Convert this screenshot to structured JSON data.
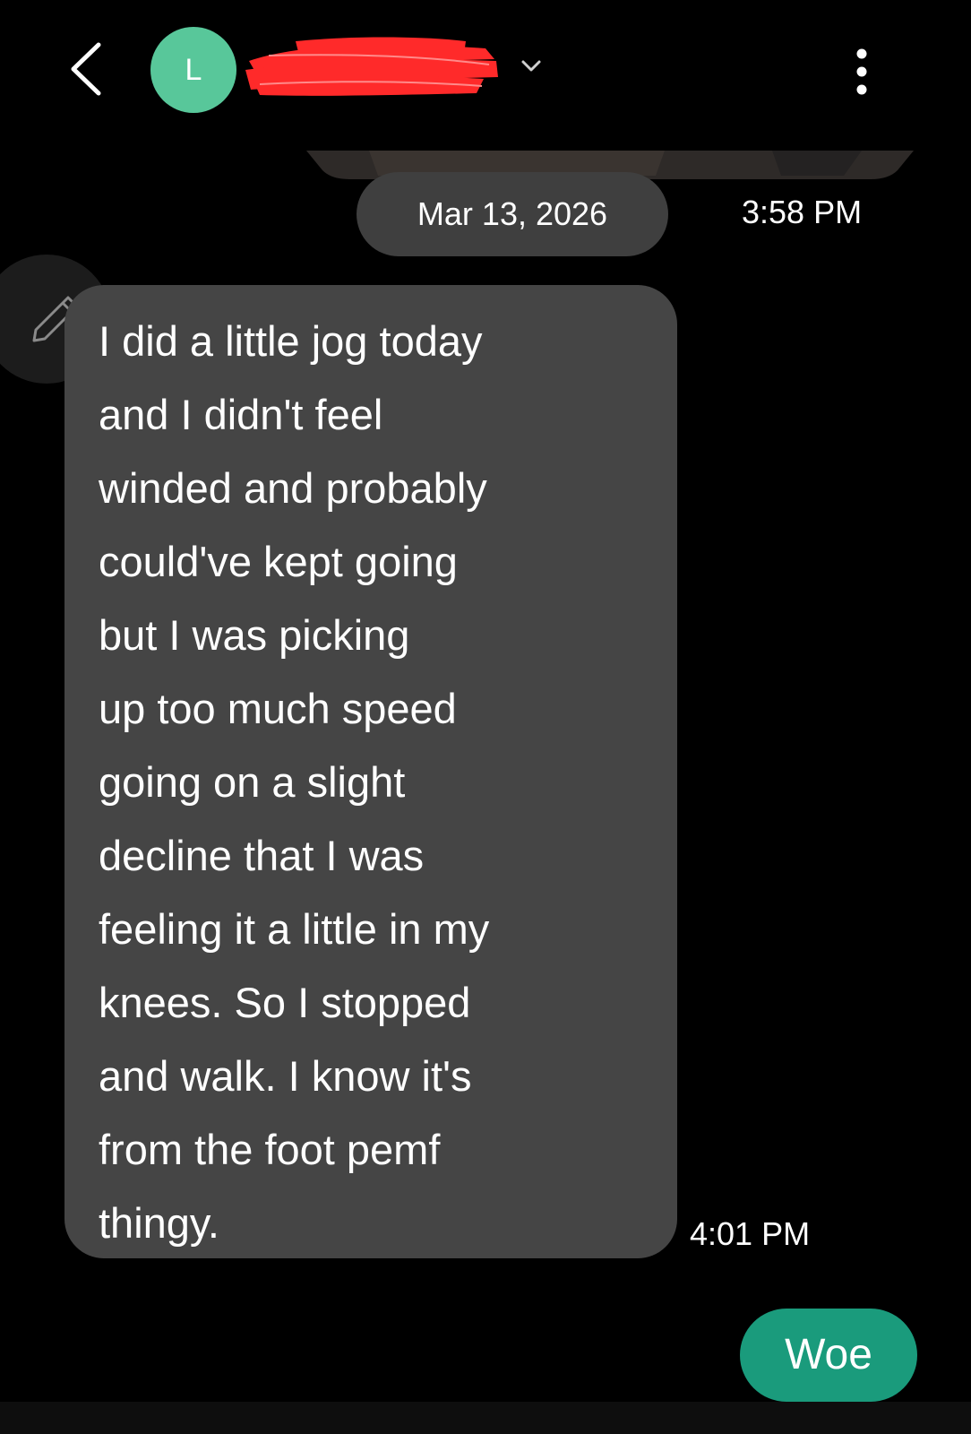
{
  "header": {
    "avatar_letter": "L",
    "back_icon": "chevron-left-icon",
    "expand_icon": "chevron-down-icon",
    "more_icon": "more-vertical-icon"
  },
  "messages": {
    "date": "Mar 13, 2026",
    "first_time": "3:58 PM",
    "incoming": {
      "lines": [
        "I did a little jog today",
        "and I didn't feel",
        "winded and probably",
        "could've kept going",
        "but I was picking",
        "up too much speed",
        "going on a slight",
        "decline that I was",
        "feeling it a little in my",
        "knees. So I stopped",
        "and walk. I know it's",
        "from the foot pemf",
        "thingy."
      ],
      "time": "4:01 PM"
    },
    "outgoing": {
      "text": "Woe"
    }
  },
  "colors": {
    "background": "#000000",
    "incoming_bubble": "#454545",
    "outgoing_bubble": "#1a9b7c",
    "avatar": "#58c79a",
    "redaction": "#ff2a2a"
  }
}
